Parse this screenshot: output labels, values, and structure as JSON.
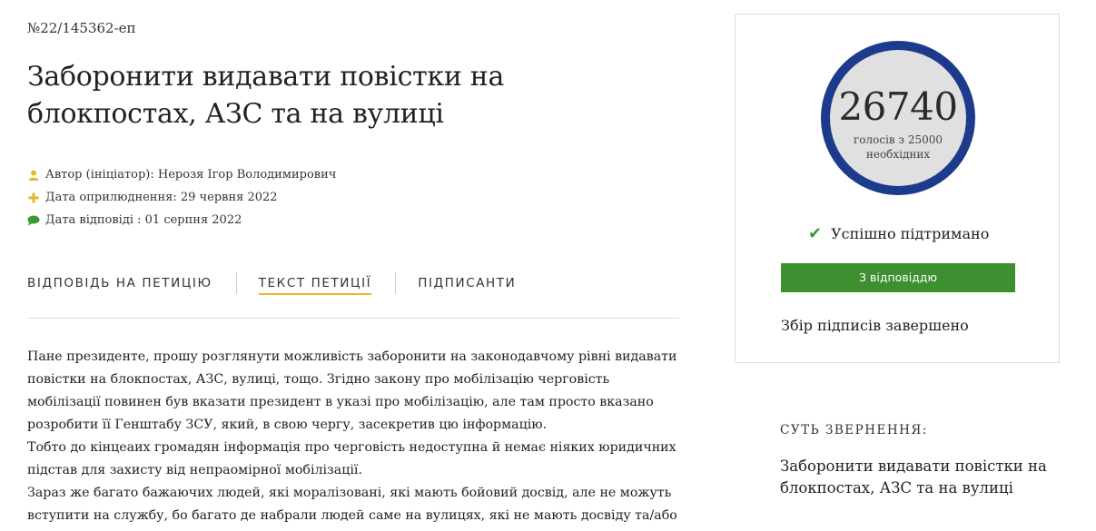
{
  "petition": {
    "number": "№22/145362-еп",
    "title": "Заборонити видавати повістки на блокпостах, АЗС та на вулиці",
    "meta": {
      "author": "Автор (ініціатор): Нерозя Ігор Володимирович",
      "published": "Дата оприлюднення: 29 червня 2022",
      "answered": "Дата відповіді : 01 серпня 2022"
    },
    "tabs": [
      {
        "label": "ВІДПОВІДЬ НА ПЕТИЦІЮ",
        "active": false
      },
      {
        "label": "ТЕКСТ ПЕТИЦІЇ",
        "active": true
      },
      {
        "label": "ПІДПИСАНТИ",
        "active": false
      }
    ],
    "body_lines": [
      "Пане президенте, прошу розглянути можливість заборонити на законодавчому рівні видавати",
      "повістки на блокпостах, АЗС, вулиці, тощо. Згідно закону про мобілізацію черговість",
      "мобілізації повинен був вказати президент в указі про мобілізацію, але там просто вказано",
      "розробити її Генштабу ЗСУ, який, в свою чергу, засекретив цю інформацію.",
      "Тобто до кінцеаих громадян інформація про черговість недоступна й немає ніяких юридичних",
      "підстав для захисту від непраомірної мобілізації.",
      "Зараз же багато бажаючих людей, які моралізовані, які мають бойовий досвід, але не можуть",
      "вступити на службу, бо багато де набрали людей саме на вулицях, які не мають досвіду та/або"
    ]
  },
  "sidebar": {
    "votes": "26740",
    "votes_sub": "голосів з 25000 необхідних",
    "status": "Успішно підтримано",
    "answer_button": "З відповіддю",
    "collection_status": "Збір підписів завершено",
    "summary_label": "СУТЬ ЗВЕРНЕННЯ:",
    "summary_text": "Заборонити видавати повістки на блокпостах, АЗС та на вулиці"
  },
  "colors": {
    "accent_yellow": "#e5b82a",
    "circle_blue": "#1c3b8c",
    "success_green": "#3d8f2f"
  },
  "icons": [
    "user-icon",
    "plus-icon",
    "comment-icon",
    "check-icon"
  ]
}
